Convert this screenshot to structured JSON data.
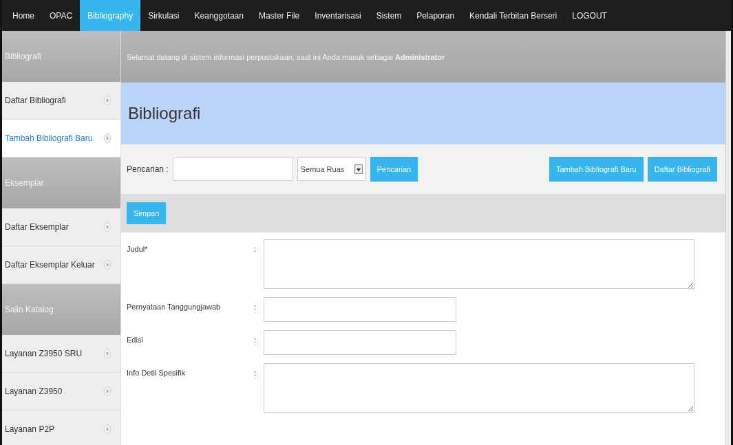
{
  "nav": [
    {
      "label": "Home",
      "selected": false
    },
    {
      "label": "OPAC",
      "selected": false
    },
    {
      "label": "Bibliography",
      "selected": true
    },
    {
      "label": "Sirkulasi",
      "selected": false
    },
    {
      "label": "Keanggotaan",
      "selected": false
    },
    {
      "label": "Master File",
      "selected": false
    },
    {
      "label": "Inventarisasi",
      "selected": false
    },
    {
      "label": "Sistem",
      "selected": false
    },
    {
      "label": "Pelaporan",
      "selected": false
    },
    {
      "label": "Kendali Terbitan Berseri",
      "selected": false
    },
    {
      "label": "LOGOUT",
      "selected": false
    }
  ],
  "sidebar": [
    {
      "kind": "header",
      "label": "Bibliografi"
    },
    {
      "kind": "item",
      "label": "Daftar Bibliografi",
      "selected": false
    },
    {
      "kind": "item",
      "label": "Tambah Bibliografi Baru",
      "selected": true
    },
    {
      "kind": "header",
      "label": "Eksemplar"
    },
    {
      "kind": "item",
      "label": "Daftar Eksemplar",
      "selected": false
    },
    {
      "kind": "item",
      "label": "Daftar Eksemplar Keluar",
      "selected": false
    },
    {
      "kind": "header",
      "label": "Salin Katalog"
    },
    {
      "kind": "item",
      "label": "Layanan Z3950 SRU",
      "selected": false
    },
    {
      "kind": "item",
      "label": "Layanan Z3950",
      "selected": false
    },
    {
      "kind": "item",
      "label": "Layanan P2P",
      "selected": false
    }
  ],
  "welcome": "Selamat datang di sistem informasi perpustakaan, saat ini Anda masuk sebagai **Administrator**",
  "page_title": "Bibliografi",
  "search": {
    "label": "Pencarian :",
    "scope": "Semua Ruas",
    "button": "Pencarian"
  },
  "actions": [
    "Tambah Bibliografi Baru",
    "Daftar Bibliografi"
  ],
  "save_button": "Simpan",
  "form": [
    {
      "label": "Judul*",
      "separator": ":",
      "kind": "textarea"
    },
    {
      "label": "Pernyataan Tanggungjawab",
      "separator": ":",
      "kind": "text"
    },
    {
      "label": "Edisi",
      "separator": ":",
      "kind": "text"
    },
    {
      "label": "Info Detil Spesifik",
      "separator": ":",
      "kind": "textarea"
    }
  ]
}
